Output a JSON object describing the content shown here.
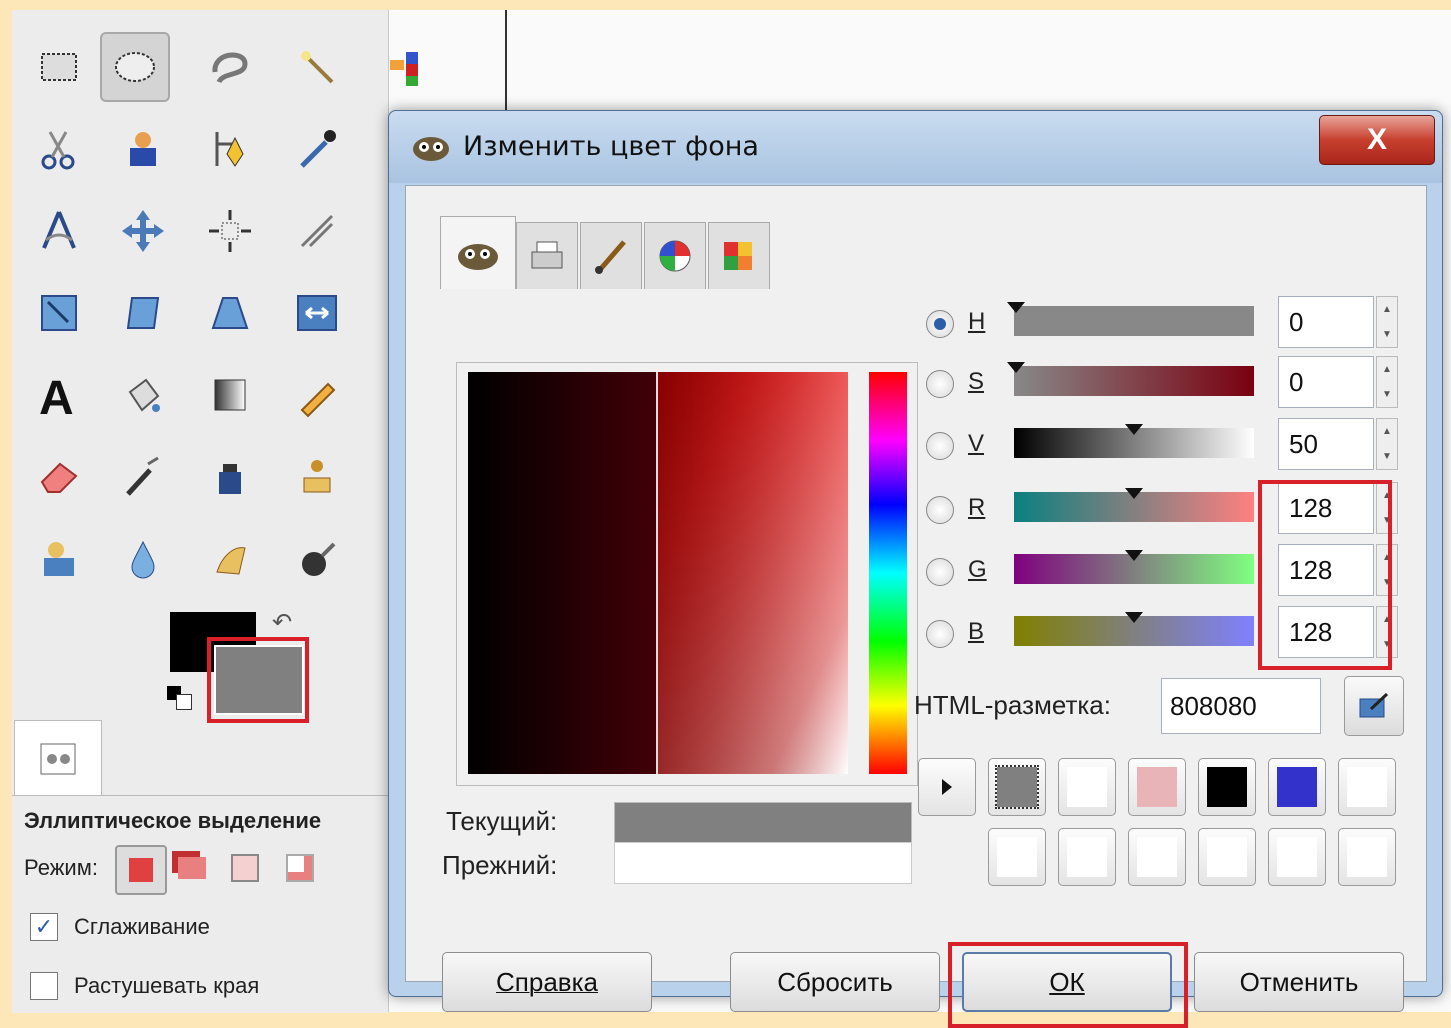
{
  "toolbox": {
    "tool_options": {
      "title": "Эллиптическое выделение",
      "mode_label": "Режим:",
      "antialias_label": "Сглаживание",
      "antialias_checked": true,
      "feather_label": "Растушевать края",
      "feather_checked": false
    },
    "fg_color": "#000000",
    "bg_color": "#808080"
  },
  "dialog": {
    "title": "Изменить цвет фона",
    "close_label": "X",
    "channels": [
      {
        "label": "H",
        "value": "0",
        "selected": true
      },
      {
        "label": "S",
        "value": "0",
        "selected": false
      },
      {
        "label": "V",
        "value": "50",
        "selected": false
      },
      {
        "label": "R",
        "value": "128",
        "selected": false
      },
      {
        "label": "G",
        "value": "128",
        "selected": false
      },
      {
        "label": "B",
        "value": "128",
        "selected": false
      }
    ],
    "html_label": "HTML-разметка:",
    "html_value": "808080",
    "current_label": "Текущий:",
    "previous_label": "Прежний:",
    "current_color": "#808080",
    "previous_color": "#ffffff",
    "history_colors": [
      "#808080",
      "#ffffff",
      "#e8b4b8",
      "#000000",
      "#3333cc",
      "#ffffff",
      "#ffffff",
      "#ffffff",
      "#ffffff",
      "#ffffff",
      "#ffffff",
      "#ffffff"
    ],
    "buttons": {
      "help": "Справка",
      "reset": "Сбросить",
      "ok": "ОК",
      "cancel": "Отменить"
    }
  }
}
